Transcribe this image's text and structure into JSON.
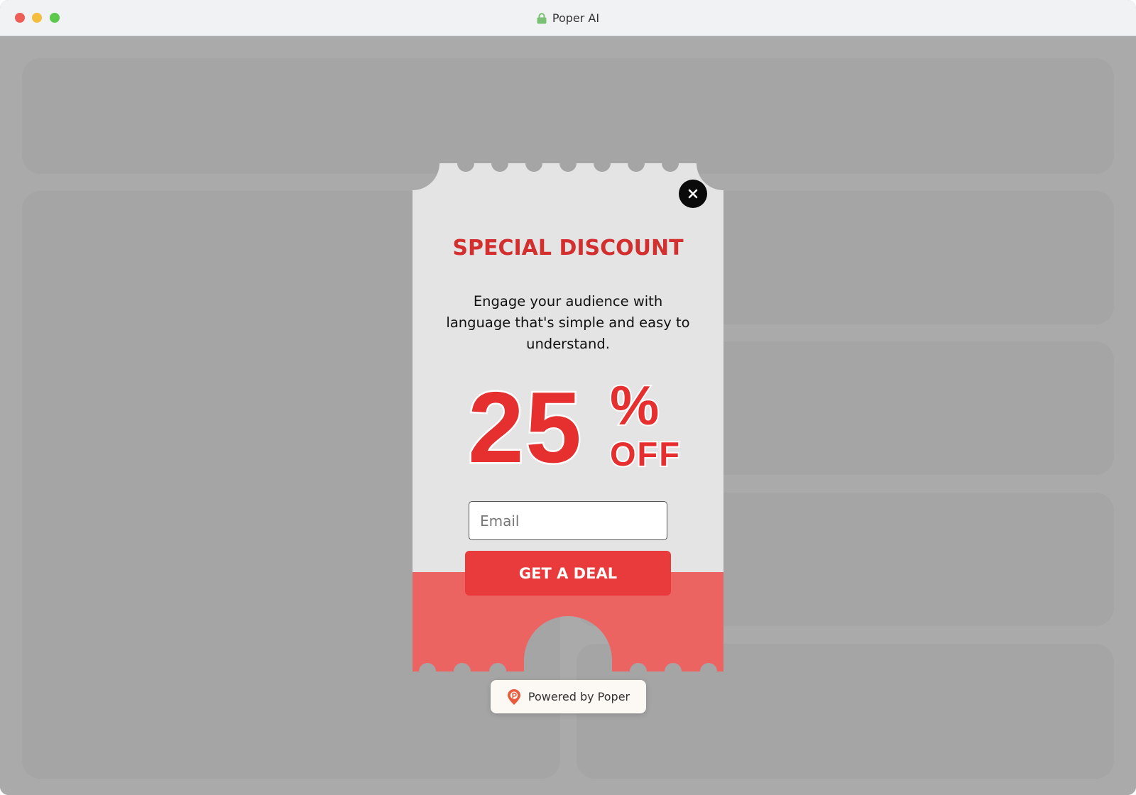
{
  "window": {
    "title": "Poper AI",
    "lock_icon": "lock-icon"
  },
  "popup": {
    "heading": "SPECIAL DISCOUNT",
    "description": "Engage your audience with language that's simple and easy to understand.",
    "discount_value": "25",
    "percent_symbol": "%",
    "off_label": "OFF",
    "email_placeholder": "Email",
    "cta_label": "GET A DEAL",
    "close_icon": "close-icon"
  },
  "branding": {
    "powered_by": "Powered by Poper",
    "logo_icon": "poper-logo-icon"
  },
  "colors": {
    "heading_red": "#d32f2f",
    "cta_red": "#e93b3b",
    "coupon_bottom": "#ec6461",
    "coupon_top": "#e4e4e4",
    "overlay_gray": "#aaaaaa"
  }
}
